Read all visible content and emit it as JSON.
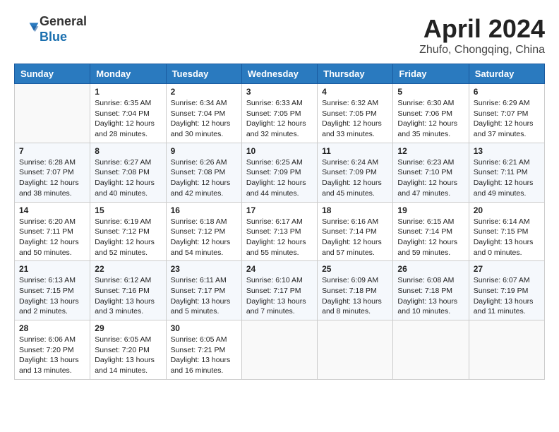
{
  "header": {
    "logo_general": "General",
    "logo_blue": "Blue",
    "title": "April 2024",
    "location": "Zhufo, Chongqing, China"
  },
  "weekdays": [
    "Sunday",
    "Monday",
    "Tuesday",
    "Wednesday",
    "Thursday",
    "Friday",
    "Saturday"
  ],
  "weeks": [
    [
      {
        "day": "",
        "info": ""
      },
      {
        "day": "1",
        "info": "Sunrise: 6:35 AM\nSunset: 7:04 PM\nDaylight: 12 hours\nand 28 minutes."
      },
      {
        "day": "2",
        "info": "Sunrise: 6:34 AM\nSunset: 7:04 PM\nDaylight: 12 hours\nand 30 minutes."
      },
      {
        "day": "3",
        "info": "Sunrise: 6:33 AM\nSunset: 7:05 PM\nDaylight: 12 hours\nand 32 minutes."
      },
      {
        "day": "4",
        "info": "Sunrise: 6:32 AM\nSunset: 7:05 PM\nDaylight: 12 hours\nand 33 minutes."
      },
      {
        "day": "5",
        "info": "Sunrise: 6:30 AM\nSunset: 7:06 PM\nDaylight: 12 hours\nand 35 minutes."
      },
      {
        "day": "6",
        "info": "Sunrise: 6:29 AM\nSunset: 7:07 PM\nDaylight: 12 hours\nand 37 minutes."
      }
    ],
    [
      {
        "day": "7",
        "info": "Sunrise: 6:28 AM\nSunset: 7:07 PM\nDaylight: 12 hours\nand 38 minutes."
      },
      {
        "day": "8",
        "info": "Sunrise: 6:27 AM\nSunset: 7:08 PM\nDaylight: 12 hours\nand 40 minutes."
      },
      {
        "day": "9",
        "info": "Sunrise: 6:26 AM\nSunset: 7:08 PM\nDaylight: 12 hours\nand 42 minutes."
      },
      {
        "day": "10",
        "info": "Sunrise: 6:25 AM\nSunset: 7:09 PM\nDaylight: 12 hours\nand 44 minutes."
      },
      {
        "day": "11",
        "info": "Sunrise: 6:24 AM\nSunset: 7:09 PM\nDaylight: 12 hours\nand 45 minutes."
      },
      {
        "day": "12",
        "info": "Sunrise: 6:23 AM\nSunset: 7:10 PM\nDaylight: 12 hours\nand 47 minutes."
      },
      {
        "day": "13",
        "info": "Sunrise: 6:21 AM\nSunset: 7:11 PM\nDaylight: 12 hours\nand 49 minutes."
      }
    ],
    [
      {
        "day": "14",
        "info": "Sunrise: 6:20 AM\nSunset: 7:11 PM\nDaylight: 12 hours\nand 50 minutes."
      },
      {
        "day": "15",
        "info": "Sunrise: 6:19 AM\nSunset: 7:12 PM\nDaylight: 12 hours\nand 52 minutes."
      },
      {
        "day": "16",
        "info": "Sunrise: 6:18 AM\nSunset: 7:12 PM\nDaylight: 12 hours\nand 54 minutes."
      },
      {
        "day": "17",
        "info": "Sunrise: 6:17 AM\nSunset: 7:13 PM\nDaylight: 12 hours\nand 55 minutes."
      },
      {
        "day": "18",
        "info": "Sunrise: 6:16 AM\nSunset: 7:14 PM\nDaylight: 12 hours\nand 57 minutes."
      },
      {
        "day": "19",
        "info": "Sunrise: 6:15 AM\nSunset: 7:14 PM\nDaylight: 12 hours\nand 59 minutes."
      },
      {
        "day": "20",
        "info": "Sunrise: 6:14 AM\nSunset: 7:15 PM\nDaylight: 13 hours\nand 0 minutes."
      }
    ],
    [
      {
        "day": "21",
        "info": "Sunrise: 6:13 AM\nSunset: 7:15 PM\nDaylight: 13 hours\nand 2 minutes."
      },
      {
        "day": "22",
        "info": "Sunrise: 6:12 AM\nSunset: 7:16 PM\nDaylight: 13 hours\nand 3 minutes."
      },
      {
        "day": "23",
        "info": "Sunrise: 6:11 AM\nSunset: 7:17 PM\nDaylight: 13 hours\nand 5 minutes."
      },
      {
        "day": "24",
        "info": "Sunrise: 6:10 AM\nSunset: 7:17 PM\nDaylight: 13 hours\nand 7 minutes."
      },
      {
        "day": "25",
        "info": "Sunrise: 6:09 AM\nSunset: 7:18 PM\nDaylight: 13 hours\nand 8 minutes."
      },
      {
        "day": "26",
        "info": "Sunrise: 6:08 AM\nSunset: 7:18 PM\nDaylight: 13 hours\nand 10 minutes."
      },
      {
        "day": "27",
        "info": "Sunrise: 6:07 AM\nSunset: 7:19 PM\nDaylight: 13 hours\nand 11 minutes."
      }
    ],
    [
      {
        "day": "28",
        "info": "Sunrise: 6:06 AM\nSunset: 7:20 PM\nDaylight: 13 hours\nand 13 minutes."
      },
      {
        "day": "29",
        "info": "Sunrise: 6:05 AM\nSunset: 7:20 PM\nDaylight: 13 hours\nand 14 minutes."
      },
      {
        "day": "30",
        "info": "Sunrise: 6:05 AM\nSunset: 7:21 PM\nDaylight: 13 hours\nand 16 minutes."
      },
      {
        "day": "",
        "info": ""
      },
      {
        "day": "",
        "info": ""
      },
      {
        "day": "",
        "info": ""
      },
      {
        "day": "",
        "info": ""
      }
    ]
  ]
}
